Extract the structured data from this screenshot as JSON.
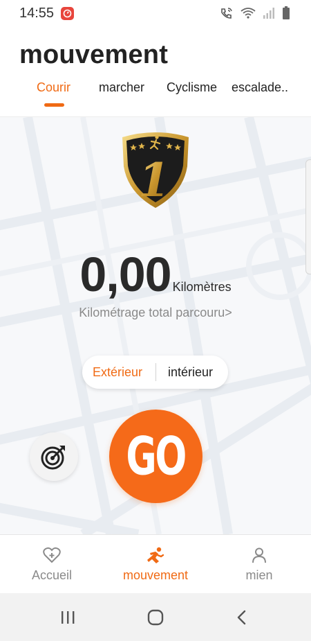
{
  "status_bar": {
    "time": "14:55"
  },
  "header": {
    "title": "mouvement",
    "tabs": [
      {
        "label": "Courir",
        "active": true
      },
      {
        "label": "marcher",
        "active": false
      },
      {
        "label": "Cyclisme",
        "active": false
      },
      {
        "label": "escalade..",
        "active": false
      }
    ]
  },
  "main": {
    "badge_number": "1",
    "distance_value": "0,00",
    "distance_unit": "Kilomètres",
    "total_link": "Kilométrage total parcouru>",
    "mode_toggle": {
      "outdoor": "Extérieur",
      "indoor": "intérieur",
      "selected": "outdoor"
    },
    "go_label": "GO"
  },
  "bottom_nav": [
    {
      "label": "Accueil",
      "icon": "heart-plus-icon",
      "active": false
    },
    {
      "label": "mouvement",
      "icon": "running-icon",
      "active": true
    },
    {
      "label": "mien",
      "icon": "person-icon",
      "active": false
    }
  ],
  "colors": {
    "accent": "#f06a14",
    "go_button": "#f56a19",
    "inactive_text": "#8a8a8a"
  }
}
